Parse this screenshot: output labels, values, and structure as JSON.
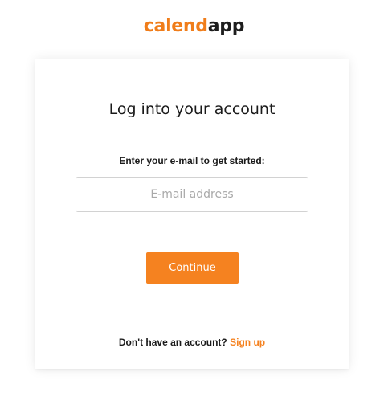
{
  "logo": {
    "part1": "calend",
    "part2": "app",
    "colors": {
      "accent": "#f07d1a",
      "dark": "#1d1d1d"
    }
  },
  "card": {
    "title": "Log into your account",
    "prompt": "Enter your e-mail to get started:",
    "email": {
      "placeholder": "E-mail address",
      "value": ""
    },
    "continue_label": "Continue",
    "signup": {
      "text": "Don't have an account?",
      "link_label": "Sign up"
    }
  },
  "colors": {
    "accent": "#f58220",
    "text": "#1a1a1a",
    "border": "#d2d2d2"
  }
}
